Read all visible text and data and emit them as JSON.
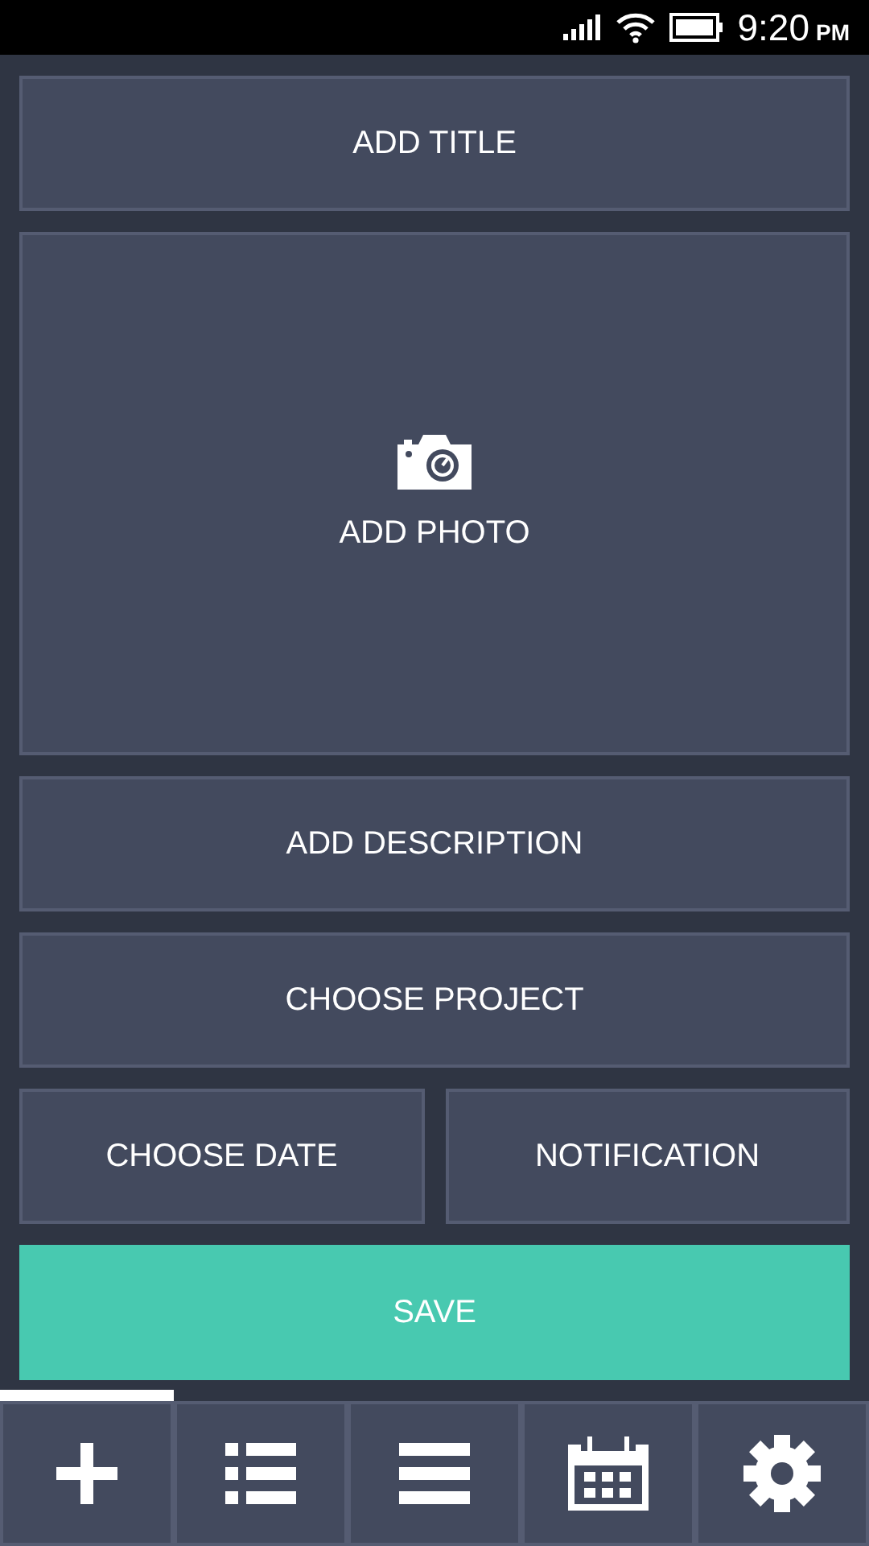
{
  "status_bar": {
    "time": "9:20",
    "period": "PM"
  },
  "form": {
    "title_button": "ADD TITLE",
    "photo_button": "ADD PHOTO",
    "description_button": "ADD DESCRIPTION",
    "project_button": "CHOOSE PROJECT",
    "date_button": "CHOOSE DATE",
    "notification_button": "NOTIFICATION",
    "save_button": "SAVE"
  },
  "tabs": [
    {
      "kind": "add",
      "selected": true
    },
    {
      "kind": "list",
      "selected": false
    },
    {
      "kind": "menu",
      "selected": false
    },
    {
      "kind": "calendar",
      "selected": false
    },
    {
      "kind": "settings",
      "selected": false
    }
  ]
}
